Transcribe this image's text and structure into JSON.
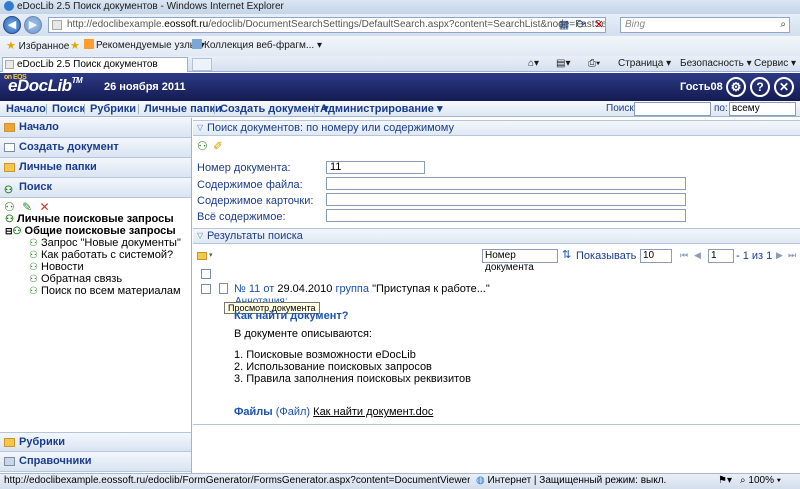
{
  "browser": {
    "title": "eDocLib 2.5 Поиск документов - Windows Internet Explorer",
    "url_prefix": "http://edoclibexample.",
    "url_host": "eossoft.ru",
    "url_rest": "/edoclib/DocumentSearchSettings/DefaultSearch.aspx?content=SearchList&node=FastSearch",
    "search_placeholder": "Bing",
    "favorites_label": "Избранное",
    "fav_links": [
      "Рекомендуемые узлы ▾",
      "Коллекция веб-фрагм... ▾"
    ],
    "tab_title": "eDocLib 2.5 Поиск документов",
    "commands": [
      "Страница ▾",
      "Безопасность ▾",
      "Сервис ▾"
    ],
    "status_url": "http://edoclibexample.eossoft.ru/edoclib/FormGenerator/FormsGenerator.aspx?content=DocumentViewer&N",
    "status_zone": "Интернет | Защищенный режим: выкл.",
    "zoom": "100%"
  },
  "header": {
    "logo_small": "on EOS",
    "logo": "eDocLib",
    "logo_tm": "TM",
    "date": "26 ноября 2011",
    "user": "Гость08"
  },
  "menu": {
    "items": [
      "Начало",
      "Поиск",
      "Рубрики",
      "Личные папки",
      "Создать документ ▾",
      "Администрирование ▾"
    ],
    "search_label": "Поиск",
    "by_label": "по:",
    "by_value": "всему"
  },
  "left": {
    "start": "Начало",
    "create": "Создать документ",
    "personal": "Личные папки",
    "search": "Поиск",
    "personal_queries": "Личные поисковые запросы",
    "common_queries": "Общие поисковые запросы",
    "queries": [
      "Запрос \"Новые документы\"",
      "Как работать с системой?",
      "Новости",
      "Обратная связь",
      "Поиск по всем материалам"
    ],
    "rubrics": "Рубрики",
    "references": "Справочники"
  },
  "search_form": {
    "title": "Поиск документов: по номеру или содержимому",
    "doc_number_label": "Номер документа:",
    "doc_number_value": "11",
    "file_content_label": "Содержимое файла:",
    "card_content_label": "Содержимое карточки:",
    "all_content_label": "Всё содержимое:"
  },
  "results": {
    "title": "Результаты поиска",
    "sort_value": "Номер документа",
    "show_label": "Показывать по:",
    "show_value": "10",
    "page_value": "1",
    "page_of": "- 1 из 1",
    "doc": {
      "number": "№ 11",
      "from": "от",
      "date": "29.04.2010",
      "group": "группа",
      "name": "\"Приступая к работе...\"",
      "annotation": "Аннотация:",
      "heading": "Как найти документ?",
      "intro": "В документе описываются:",
      "points": [
        "1. Поисковые возможности eDocLib",
        "2. Использование поисковых запросов",
        "3. Правила заполнения поисковых реквизитов"
      ],
      "files_label": "Файлы",
      "files_paren": "(Файл)",
      "file_name": "Как найти документ.doc"
    },
    "tooltip": "Просмотр документа"
  }
}
